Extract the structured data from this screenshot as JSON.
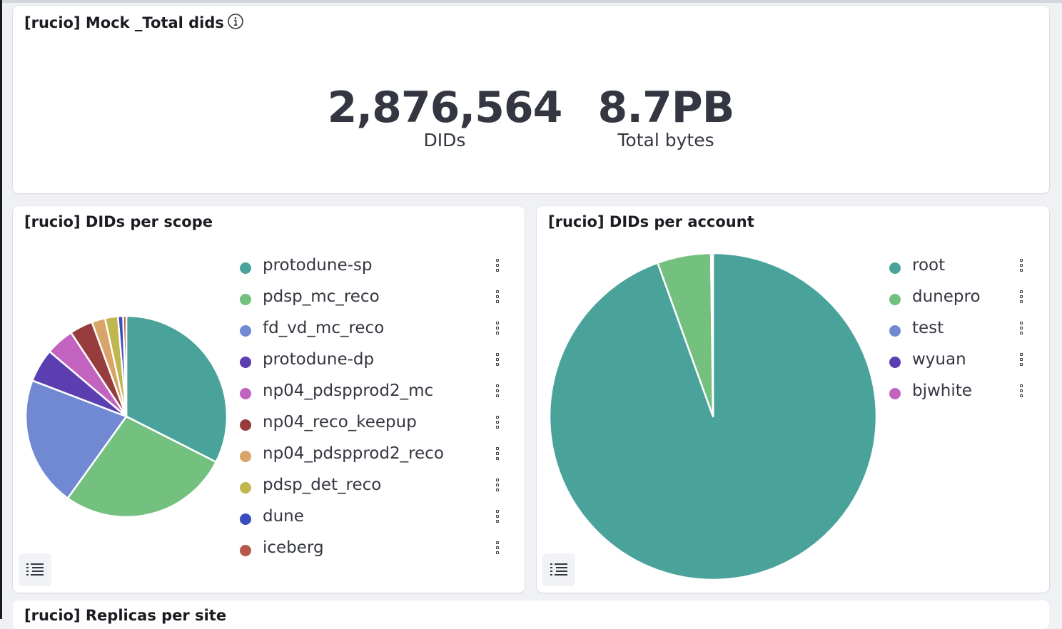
{
  "panel_total": {
    "title": "[rucio] Mock _Total dids",
    "metrics": [
      {
        "value": "2,876,564",
        "label": "DIDs"
      },
      {
        "value": "8.7PB",
        "label": "Total bytes"
      }
    ]
  },
  "panel_scope": {
    "title": "[rucio] DIDs per scope",
    "legend": [
      {
        "label": "protodune-sp",
        "color": "#4aa39a"
      },
      {
        "label": "pdsp_mc_reco",
        "color": "#74c07f"
      },
      {
        "label": "fd_vd_mc_reco",
        "color": "#7189d2"
      },
      {
        "label": "protodune-dp",
        "color": "#5b3fb0"
      },
      {
        "label": "np04_pdspprod2_mc",
        "color": "#c363c0"
      },
      {
        "label": "np04_reco_keepup",
        "color": "#963c3c"
      },
      {
        "label": "np04_pdspprod2_reco",
        "color": "#d9a467"
      },
      {
        "label": "pdsp_det_reco",
        "color": "#bfb64d"
      },
      {
        "label": "dune",
        "color": "#3a4dbd"
      },
      {
        "label": "iceberg",
        "color": "#b8584a"
      }
    ]
  },
  "panel_account": {
    "title": "[rucio] DIDs per account",
    "legend": [
      {
        "label": "root",
        "color": "#4aa39a"
      },
      {
        "label": "dunepro",
        "color": "#74c07f"
      },
      {
        "label": "test",
        "color": "#7189d2"
      },
      {
        "label": "wyuan",
        "color": "#5b3fb0"
      },
      {
        "label": "bjwhite",
        "color": "#c363c0"
      }
    ]
  },
  "bottom_panel": {
    "title": "[rucio] Replicas per site"
  },
  "chart_data": [
    {
      "type": "pie",
      "title": "[rucio] DIDs per scope",
      "categories": [
        "protodune-sp",
        "pdsp_mc_reco",
        "fd_vd_mc_reco",
        "protodune-dp",
        "np04_pdspprod2_mc",
        "np04_reco_keepup",
        "np04_pdspprod2_reco",
        "pdsp_det_reco",
        "dune",
        "iceberg"
      ],
      "values": [
        31.5,
        26.6,
        20.3,
        5.2,
        4.4,
        3.6,
        2.1,
        2.0,
        0.8,
        0.5
      ],
      "colors": [
        "#4aa39a",
        "#74c07f",
        "#7189d2",
        "#5b3fb0",
        "#c363c0",
        "#963c3c",
        "#d9a467",
        "#bfb64d",
        "#3a4dbd",
        "#b8584a"
      ],
      "legend": "right"
    },
    {
      "type": "pie",
      "title": "[rucio] DIDs per account",
      "categories": [
        "root",
        "dunepro",
        "test",
        "wyuan",
        "bjwhite"
      ],
      "values": [
        94.5,
        5.3,
        0.1,
        0.05,
        0.05
      ],
      "colors": [
        "#4aa39a",
        "#74c07f",
        "#7189d2",
        "#5b3fb0",
        "#c363c0"
      ],
      "legend": "right"
    }
  ]
}
